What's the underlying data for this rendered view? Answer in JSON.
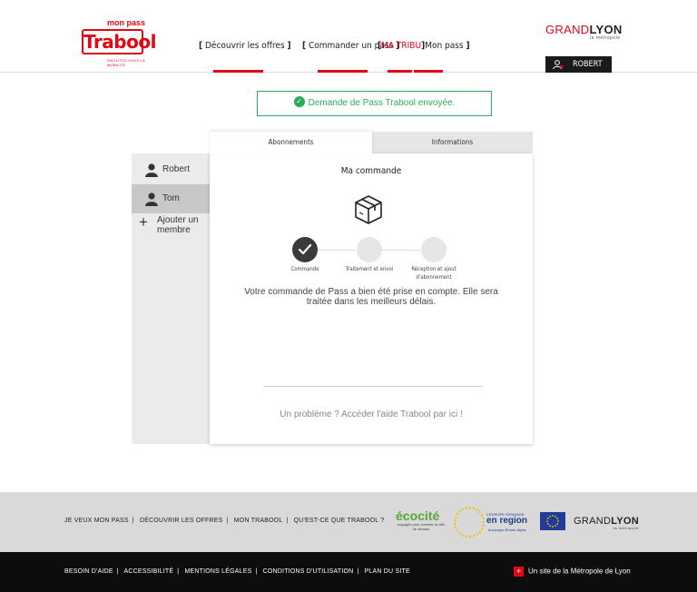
{
  "header": {
    "logo": {
      "top": "mon pass",
      "word": "Trabool",
      "tagline": "FACILITEZ-VOUS LA MOBILITÉ"
    },
    "nav": [
      {
        "label": "Découvrir les offres"
      },
      {
        "label": "Commander un pass"
      },
      {
        "label_red": "MA TRIBU",
        "label": "Mon pass"
      }
    ],
    "brand": {
      "grand": "GRAND",
      "lyon": "LYON",
      "sub": "la métropole"
    },
    "user": {
      "name": "ROBERT"
    }
  },
  "banner": {
    "text": "Demande de Pass Trabool envoyée."
  },
  "sidebar": {
    "members": [
      {
        "name": "Robert",
        "selected": false
      },
      {
        "name": "Tom",
        "selected": true
      }
    ],
    "add_member_label": "Ajouter un membre"
  },
  "tabs": [
    {
      "label": "Abonnements",
      "active": true
    },
    {
      "label": "Informations",
      "active": false
    }
  ],
  "card": {
    "title": "Ma commande",
    "steps": [
      {
        "label": "Commande",
        "done": true
      },
      {
        "label": "Traitement et envoi",
        "done": false
      },
      {
        "label": "Réception et ajout d'abonnement",
        "done": false
      }
    ],
    "message": "Votre commande de Pass a bien été prise en compte. Elle sera traitée dans les meilleurs délais.",
    "help_link": "Un problème ? Accéder l'aide Trabool par ici !"
  },
  "footer": {
    "primary_links": [
      "JE VEUX MON PASS",
      "DÉCOUVRIR LES OFFRES",
      "MON TRABOOL",
      "QU'EST-CE QUE TRABOOL ?"
    ],
    "ecocite": {
      "title": "écocité",
      "sub": "engagée pour inventer la ville de demain"
    },
    "region": {
      "line1": "L'EUROPE S'ENGAGE",
      "line2": "en region",
      "line3": "Auvergne-Rhône-Alpes"
    },
    "grandlyon": {
      "grand": "GRAND",
      "lyon": "LYON",
      "sub": "la métropole"
    },
    "secondary_links": [
      "BESOIN D'AIDE",
      "ACCESSIBILITÉ",
      "MENTIONS LÉGALES",
      "CONDITIONS D'UTILISATION",
      "PLAN DU SITE"
    ],
    "metropole": "Un site de la Métropole de Lyon"
  },
  "colors": {
    "brand_red": "#e30613",
    "success_green": "#2eaa5c",
    "dark": "#1a1a1a"
  }
}
